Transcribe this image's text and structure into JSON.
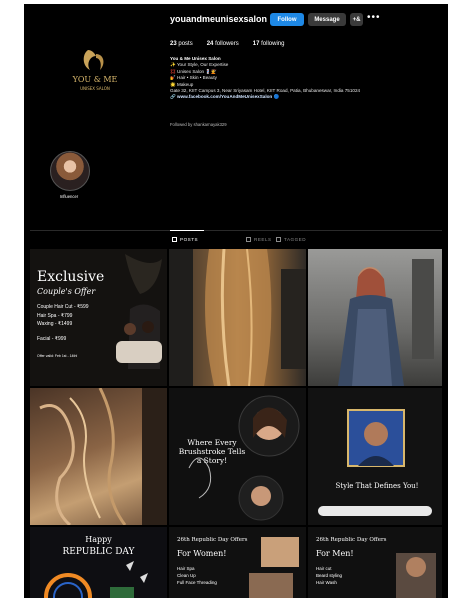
{
  "profile": {
    "username": "youandmeunisexsalon",
    "follow_label": "Follow",
    "message_label": "Message",
    "adduser_label": "+&",
    "more_label": "•••",
    "stats": {
      "posts": "23",
      "posts_label": "posts",
      "followers": "24",
      "followers_label": "followers",
      "following": "17",
      "following_label": "following"
    },
    "bio": {
      "name": "You & Me Unisex Salon",
      "line1": "✨ Your Style, Our Expertise",
      "line2": "💢 Unisex Salon 💈💇",
      "line3": "💅 Hair • Skin • Beauty",
      "line4": "🌟 Makeup",
      "address": "Gate 32, KIIT Campus 3, Near Sriyasam Hotel, KIIT Road, Patia, Bhubaneswar, India 751024",
      "link": "🔗 www.facebook.com/YouAndMeUnisexSalon 🔵"
    },
    "followed_by": "Followed by shankarnayak329",
    "logo_text": "YOU & ME",
    "logo_sub": "UNISEX SALON"
  },
  "highlight": {
    "label": "Influencer"
  },
  "tabs": [
    {
      "label": "POSTS"
    },
    {
      "label": "REELS"
    },
    {
      "label": "TAGGED"
    }
  ],
  "posts": {
    "p1": {
      "title": "Exclusive",
      "subtitle": "Couple's Offer",
      "items": [
        "Couple Hair Cut - ₹599",
        "Hair Spa - ₹799",
        "Waxing - ₹1499",
        "Facial - ₹999"
      ],
      "footer": "Offer valid: Feb 1st - 14th!"
    },
    "p5": {
      "title": "Where Every Brushstroke Tells a Story!"
    },
    "p6": {
      "title": "Style That Defines You!"
    },
    "p7": {
      "line1": "Happy",
      "line2": "REPUBLIC DAY"
    },
    "p8": {
      "title": "26th Republic Day Offers",
      "subtitle": "For Women!",
      "items": [
        "Hair Spa",
        "Clean Up",
        "Full Face Threading"
      ]
    },
    "p9": {
      "title": "26th Republic Day Offers",
      "subtitle": "For Men!",
      "items": [
        "Hair cut",
        "Beard styling",
        "Hair Wash"
      ]
    }
  },
  "colors": {
    "follow_blue": "#1e88e5",
    "gold": "#d8b76c"
  }
}
